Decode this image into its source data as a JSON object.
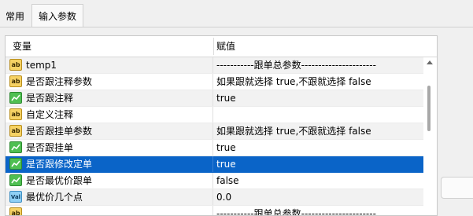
{
  "tabs": [
    {
      "label": "常用"
    },
    {
      "label": "输入参数"
    }
  ],
  "table": {
    "headers": {
      "variable": "变量",
      "value": "赋值"
    },
    "rows": [
      {
        "icon": "ab",
        "name": "temp1",
        "value": "-----------跟单总参数----------------------"
      },
      {
        "icon": "ab",
        "name": "是否跟注释参数",
        "value": "如果跟就选择 true,不跟就选择 false"
      },
      {
        "icon": "bool",
        "name": "是否跟注释",
        "value": "true"
      },
      {
        "icon": "ab",
        "name": "自定义注释",
        "value": ""
      },
      {
        "icon": "ab",
        "name": "是否跟挂单参数",
        "value": "如果跟就选择 true,不跟就选择 false"
      },
      {
        "icon": "bool",
        "name": "是否跟挂单",
        "value": "true"
      },
      {
        "icon": "bool",
        "name": "是否跟修改定单",
        "value": "true",
        "selected": true
      },
      {
        "icon": "bool",
        "name": "是否最优价跟单",
        "value": "false"
      },
      {
        "icon": "num",
        "name": "最优价几个点",
        "value": "0.0"
      },
      {
        "icon": "ab",
        "name": "",
        "value": "-----------跟单总参数----------------------"
      }
    ]
  },
  "icon_labels": {
    "ab": "ab",
    "num": "Val"
  },
  "colors": {
    "selected_row": "#0a64c8",
    "alt_row": "#f2f2f2"
  }
}
